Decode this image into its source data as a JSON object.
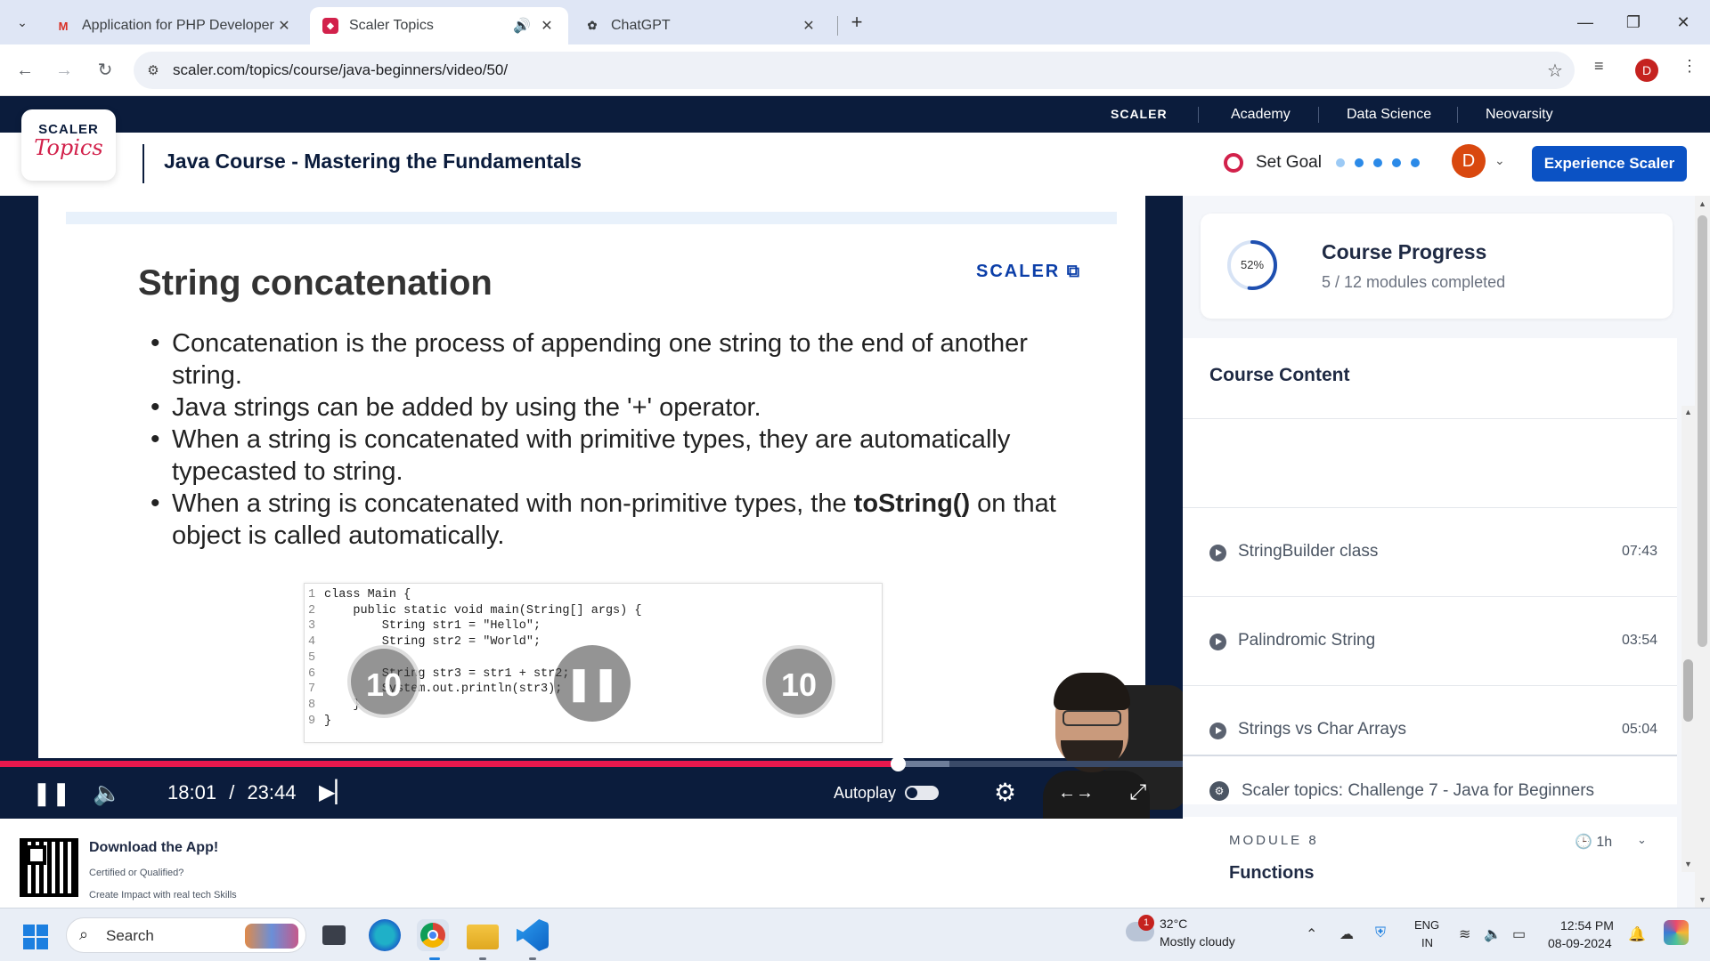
{
  "browser": {
    "tabs": [
      {
        "title": "Application for PHP Developer |",
        "favicon": "gmail-icon"
      },
      {
        "title": "Scaler Topics",
        "favicon": "scaler-topics-icon"
      },
      {
        "title": "ChatGPT",
        "favicon": "chatgpt-icon"
      }
    ],
    "url": "scaler.com/topics/course/java-beginners/video/50/",
    "profile_initial": "D"
  },
  "topnav": {
    "brand": "SCALER",
    "items": [
      "Academy",
      "Data Science",
      "Neovarsity"
    ]
  },
  "header": {
    "logo_line1": "SCALER",
    "logo_line2": "Topics",
    "course_title": "Java Course - Mastering the Fundamentals",
    "set_goal": "Set Goal",
    "avatar_initial": "D",
    "cta": "Experience Scaler"
  },
  "slide": {
    "title": "String concatenation",
    "logo": "SCALER",
    "bullets": [
      {
        "pre": "Concatenation is the process of appending one string to the end of another string.",
        "bold": "",
        "post": ""
      },
      {
        "pre": "Java strings can be added by using the '+' operator.",
        "bold": "",
        "post": ""
      },
      {
        "pre": "When a string is concatenated with primitive types, they are automatically typecasted to string.",
        "bold": "",
        "post": ""
      },
      {
        "pre": "When a string is concatenated with non-primitive types, the ",
        "bold": "toString()",
        "post": " on that object is called automatically."
      }
    ],
    "code": [
      {
        "n": "1",
        "t": "class Main {"
      },
      {
        "n": "2",
        "t": "    public static void main(String[] args) {"
      },
      {
        "n": "3",
        "t": "        String str1 = \"Hello\";"
      },
      {
        "n": "4",
        "t": "        String str2 = \"World\";"
      },
      {
        "n": "5",
        "t": ""
      },
      {
        "n": "6",
        "t": "        String str3 = str1 + str2;"
      },
      {
        "n": "7",
        "t": "        System.out.println(str3);"
      },
      {
        "n": "8",
        "t": "    }"
      },
      {
        "n": "9",
        "t": "}"
      }
    ],
    "rewind_label": "10",
    "forward_label": "10"
  },
  "player": {
    "current_time": "18:01",
    "separator": "/",
    "duration": "23:44",
    "played_fraction": 0.759,
    "buffered_fraction": 0.803,
    "autoplay_label": "Autoplay",
    "autoplay_on": false
  },
  "sidebar": {
    "progress_percent": 52,
    "progress_percent_label": "52%",
    "progress_title": "Course Progress",
    "progress_sub": "5 / 12 modules completed",
    "content_title": "Course Content",
    "lessons": [
      {
        "name": "StringBuilder class",
        "duration": "07:43"
      },
      {
        "name": "Palindromic String",
        "duration": "03:54"
      },
      {
        "name": "Strings vs Char Arrays",
        "duration": "05:04"
      }
    ],
    "challenge": "Scaler topics: Challenge 7 - Java for Beginners",
    "module_label": "MODULE 8",
    "module_time": "1h",
    "module_next": "Functions"
  },
  "download": {
    "title": "Download the App!",
    "sub1": "Certified or Qualified?",
    "sub2": "Create Impact with real tech Skills"
  },
  "taskbar": {
    "search": "Search",
    "weather_badge": "1",
    "temperature": "32°C",
    "weather": "Mostly cloudy",
    "lang1": "ENG",
    "lang2": "IN",
    "time": "12:54 PM",
    "date": "08-09-2024"
  },
  "colors": {
    "brand_navy": "#0b1c3c",
    "accent_red": "#e8184d",
    "cta_blue": "#0b52c4",
    "progress_blue": "#1e4fb0"
  }
}
